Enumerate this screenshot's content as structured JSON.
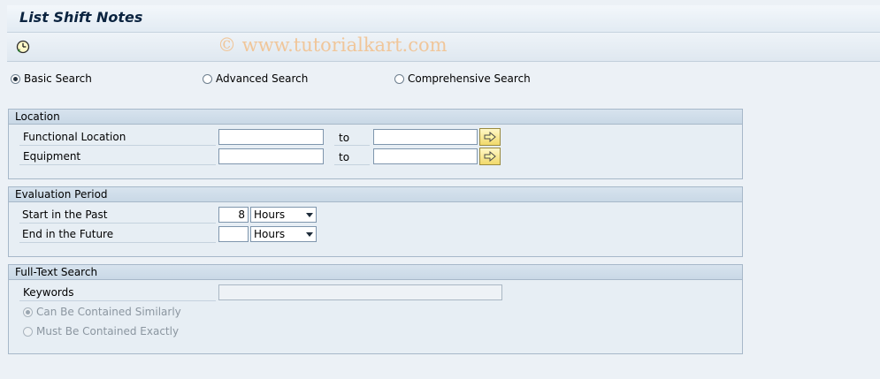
{
  "window": {
    "title": "List Shift Notes",
    "watermark": "© www.tutorialkart.com"
  },
  "toolbar": {
    "execute_icon": "execute-clock-icon"
  },
  "search_mode": {
    "options": [
      "Basic Search",
      "Advanced Search",
      "Comprehensive Search"
    ],
    "selected": "Basic Search"
  },
  "location": {
    "title": "Location",
    "functional_location_label": "Functional Location",
    "equipment_label": "Equipment",
    "to_label": "to",
    "functional_location_from": "",
    "functional_location_to": "",
    "equipment_from": "",
    "equipment_to": "",
    "multiple_selection_icon": "arrow-right-icon"
  },
  "evaluation_period": {
    "title": "Evaluation Period",
    "start_label": "Start in the Past",
    "end_label": "End in the Future",
    "start_value": "8",
    "start_unit": "Hours",
    "end_value": "",
    "end_unit": "Hours"
  },
  "full_text_search": {
    "title": "Full-Text Search",
    "keywords_label": "Keywords",
    "keywords_value": "",
    "option_similar": "Can Be Contained Similarly",
    "option_exact": "Must Be Contained Exactly",
    "selected": "Can Be Contained Similarly"
  },
  "colors": {
    "background": "#ecf1f6",
    "group_header": "#c9d8e6",
    "title_text": "#0b2440",
    "watermark": "#f0c69a"
  }
}
